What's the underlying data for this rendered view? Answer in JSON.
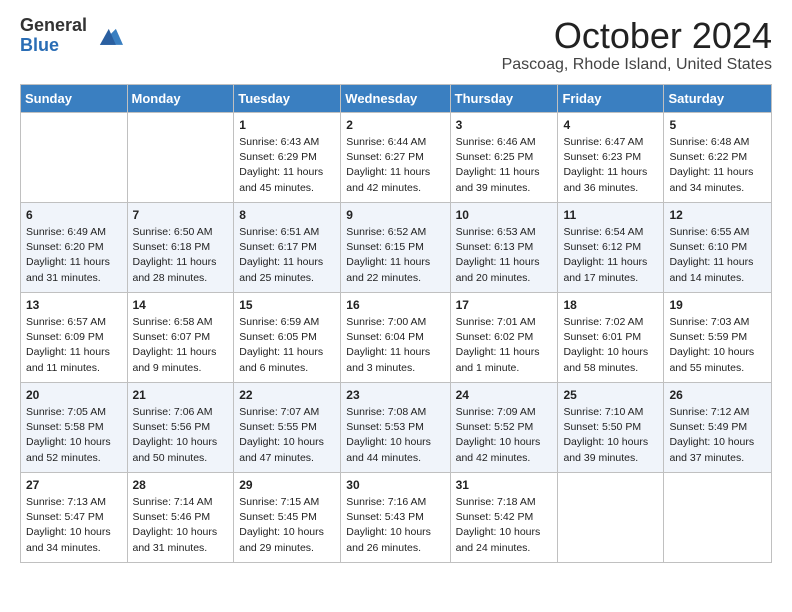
{
  "header": {
    "logo_general": "General",
    "logo_blue": "Blue",
    "month_title": "October 2024",
    "location": "Pascoag, Rhode Island, United States"
  },
  "days_of_week": [
    "Sunday",
    "Monday",
    "Tuesday",
    "Wednesday",
    "Thursday",
    "Friday",
    "Saturday"
  ],
  "weeks": [
    [
      {
        "day": "",
        "info": ""
      },
      {
        "day": "",
        "info": ""
      },
      {
        "day": "1",
        "info": "Sunrise: 6:43 AM\nSunset: 6:29 PM\nDaylight: 11 hours and 45 minutes."
      },
      {
        "day": "2",
        "info": "Sunrise: 6:44 AM\nSunset: 6:27 PM\nDaylight: 11 hours and 42 minutes."
      },
      {
        "day": "3",
        "info": "Sunrise: 6:46 AM\nSunset: 6:25 PM\nDaylight: 11 hours and 39 minutes."
      },
      {
        "day": "4",
        "info": "Sunrise: 6:47 AM\nSunset: 6:23 PM\nDaylight: 11 hours and 36 minutes."
      },
      {
        "day": "5",
        "info": "Sunrise: 6:48 AM\nSunset: 6:22 PM\nDaylight: 11 hours and 34 minutes."
      }
    ],
    [
      {
        "day": "6",
        "info": "Sunrise: 6:49 AM\nSunset: 6:20 PM\nDaylight: 11 hours and 31 minutes."
      },
      {
        "day": "7",
        "info": "Sunrise: 6:50 AM\nSunset: 6:18 PM\nDaylight: 11 hours and 28 minutes."
      },
      {
        "day": "8",
        "info": "Sunrise: 6:51 AM\nSunset: 6:17 PM\nDaylight: 11 hours and 25 minutes."
      },
      {
        "day": "9",
        "info": "Sunrise: 6:52 AM\nSunset: 6:15 PM\nDaylight: 11 hours and 22 minutes."
      },
      {
        "day": "10",
        "info": "Sunrise: 6:53 AM\nSunset: 6:13 PM\nDaylight: 11 hours and 20 minutes."
      },
      {
        "day": "11",
        "info": "Sunrise: 6:54 AM\nSunset: 6:12 PM\nDaylight: 11 hours and 17 minutes."
      },
      {
        "day": "12",
        "info": "Sunrise: 6:55 AM\nSunset: 6:10 PM\nDaylight: 11 hours and 14 minutes."
      }
    ],
    [
      {
        "day": "13",
        "info": "Sunrise: 6:57 AM\nSunset: 6:09 PM\nDaylight: 11 hours and 11 minutes."
      },
      {
        "day": "14",
        "info": "Sunrise: 6:58 AM\nSunset: 6:07 PM\nDaylight: 11 hours and 9 minutes."
      },
      {
        "day": "15",
        "info": "Sunrise: 6:59 AM\nSunset: 6:05 PM\nDaylight: 11 hours and 6 minutes."
      },
      {
        "day": "16",
        "info": "Sunrise: 7:00 AM\nSunset: 6:04 PM\nDaylight: 11 hours and 3 minutes."
      },
      {
        "day": "17",
        "info": "Sunrise: 7:01 AM\nSunset: 6:02 PM\nDaylight: 11 hours and 1 minute."
      },
      {
        "day": "18",
        "info": "Sunrise: 7:02 AM\nSunset: 6:01 PM\nDaylight: 10 hours and 58 minutes."
      },
      {
        "day": "19",
        "info": "Sunrise: 7:03 AM\nSunset: 5:59 PM\nDaylight: 10 hours and 55 minutes."
      }
    ],
    [
      {
        "day": "20",
        "info": "Sunrise: 7:05 AM\nSunset: 5:58 PM\nDaylight: 10 hours and 52 minutes."
      },
      {
        "day": "21",
        "info": "Sunrise: 7:06 AM\nSunset: 5:56 PM\nDaylight: 10 hours and 50 minutes."
      },
      {
        "day": "22",
        "info": "Sunrise: 7:07 AM\nSunset: 5:55 PM\nDaylight: 10 hours and 47 minutes."
      },
      {
        "day": "23",
        "info": "Sunrise: 7:08 AM\nSunset: 5:53 PM\nDaylight: 10 hours and 44 minutes."
      },
      {
        "day": "24",
        "info": "Sunrise: 7:09 AM\nSunset: 5:52 PM\nDaylight: 10 hours and 42 minutes."
      },
      {
        "day": "25",
        "info": "Sunrise: 7:10 AM\nSunset: 5:50 PM\nDaylight: 10 hours and 39 minutes."
      },
      {
        "day": "26",
        "info": "Sunrise: 7:12 AM\nSunset: 5:49 PM\nDaylight: 10 hours and 37 minutes."
      }
    ],
    [
      {
        "day": "27",
        "info": "Sunrise: 7:13 AM\nSunset: 5:47 PM\nDaylight: 10 hours and 34 minutes."
      },
      {
        "day": "28",
        "info": "Sunrise: 7:14 AM\nSunset: 5:46 PM\nDaylight: 10 hours and 31 minutes."
      },
      {
        "day": "29",
        "info": "Sunrise: 7:15 AM\nSunset: 5:45 PM\nDaylight: 10 hours and 29 minutes."
      },
      {
        "day": "30",
        "info": "Sunrise: 7:16 AM\nSunset: 5:43 PM\nDaylight: 10 hours and 26 minutes."
      },
      {
        "day": "31",
        "info": "Sunrise: 7:18 AM\nSunset: 5:42 PM\nDaylight: 10 hours and 24 minutes."
      },
      {
        "day": "",
        "info": ""
      },
      {
        "day": "",
        "info": ""
      }
    ]
  ]
}
